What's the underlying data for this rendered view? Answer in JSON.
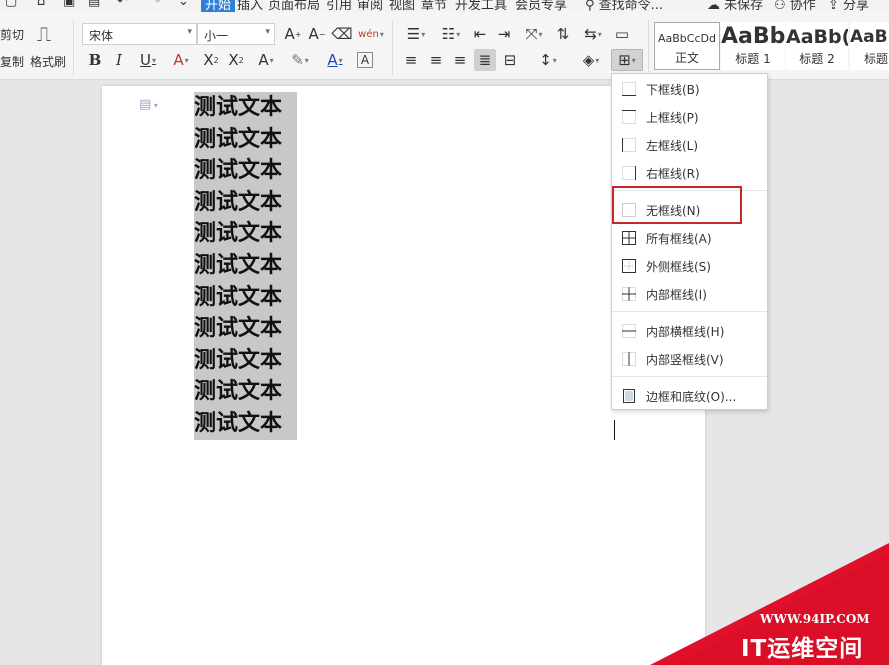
{
  "menubar": {
    "tabs": [
      "开始",
      "插入",
      "页面布局",
      "引用",
      "审阅",
      "视图",
      "章节",
      "开发工具",
      "会员专享"
    ],
    "search_placeholder": "查找命令...",
    "right_items": [
      "未保存",
      "协作",
      "分享"
    ]
  },
  "ribbon": {
    "cut_label": "剪切",
    "copy_label": "复制",
    "format_painter_label": "格式刷",
    "font_name": "宋体",
    "font_size": "小一",
    "wen_glyph": "wén",
    "styles": [
      {
        "sample": "AaBbCcDd",
        "name": "正文"
      },
      {
        "sample": "AaBb",
        "name": "标题 1"
      },
      {
        "sample": "AaBb(",
        "name": "标题 2"
      },
      {
        "sample": "AaBl",
        "name": "标题"
      }
    ]
  },
  "document": {
    "lines": [
      "测试文本",
      "测试文本",
      "测试文本",
      "测试文本",
      "测试文本",
      "测试文本",
      "测试文本",
      "测试文本",
      "测试文本",
      "测试文本",
      "测试文本"
    ]
  },
  "border_menu": {
    "items": [
      {
        "label": "下框线(B)",
        "icon": "bottom-border-icon"
      },
      {
        "label": "上框线(P)",
        "icon": "top-border-icon"
      },
      {
        "label": "左框线(L)",
        "icon": "left-border-icon"
      },
      {
        "label": "右框线(R)",
        "icon": "right-border-icon"
      },
      {
        "label": "无框线(N)",
        "icon": "no-border-icon",
        "highlighted": true
      },
      {
        "label": "所有框线(A)",
        "icon": "all-borders-icon"
      },
      {
        "label": "外侧框线(S)",
        "icon": "outside-borders-icon"
      },
      {
        "label": "内部框线(I)",
        "icon": "inside-borders-icon"
      },
      {
        "label": "内部横框线(H)",
        "icon": "inside-horizontal-border-icon"
      },
      {
        "label": "内部竖框线(V)",
        "icon": "inside-vertical-border-icon"
      },
      {
        "label": "边框和底纹(O)...",
        "icon": "borders-and-shading-icon"
      }
    ]
  },
  "watermark": {
    "url": "WWW.94IP.COM",
    "name": "IT运维空间"
  },
  "colors": {
    "accent": "#2f7fd6",
    "highlight_box": "#c62828",
    "watermark_red": "#e0102a",
    "selection": "#c8c8c8"
  }
}
